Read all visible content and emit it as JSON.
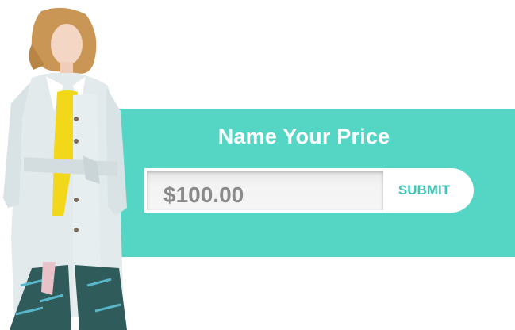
{
  "promo": {
    "title": "Name Your Price",
    "price_value": "$100.00",
    "submit_label": "SUBMIT"
  },
  "colors": {
    "banner": "#55d5c4",
    "submit_text": "#3fc6b5",
    "input_text": "#8a8a8a"
  },
  "icons": [
    "fashion-model-photo"
  ]
}
